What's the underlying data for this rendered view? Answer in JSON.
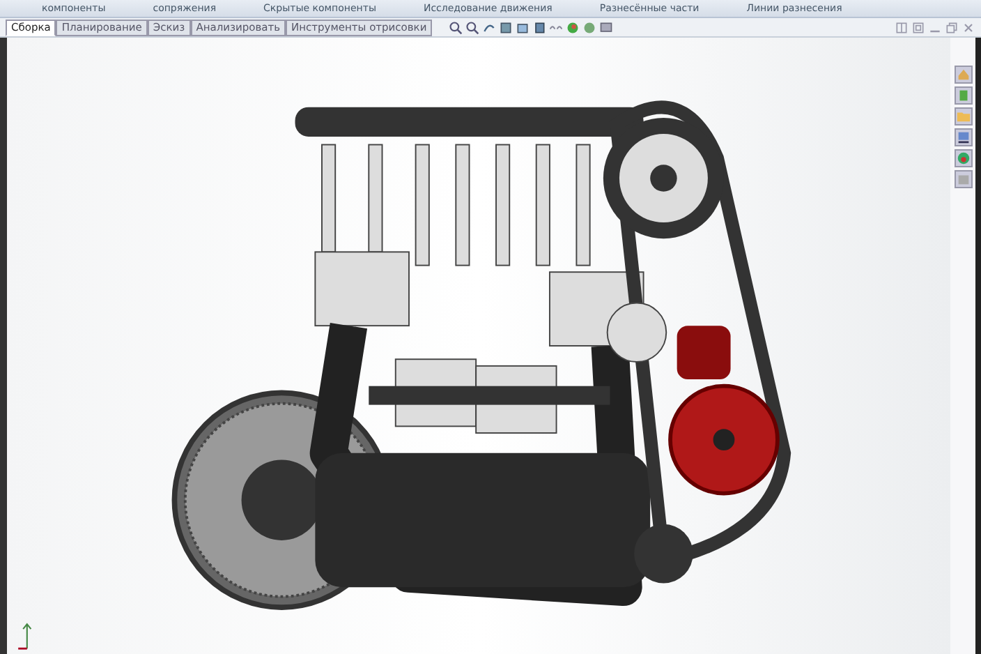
{
  "ribbon": {
    "labels": [
      "компоненты",
      "сопряжения",
      "Скрытые компоненты",
      "Исследование движения",
      "Разнесённые части",
      "Линии разнесения"
    ]
  },
  "tabs": [
    {
      "label": "Сборка",
      "selected": true
    },
    {
      "label": "Планирование",
      "selected": false
    },
    {
      "label": "Эскиз",
      "selected": false
    },
    {
      "label": "Анализировать",
      "selected": false
    },
    {
      "label": "Инструменты отрисовки",
      "selected": false
    }
  ]
}
